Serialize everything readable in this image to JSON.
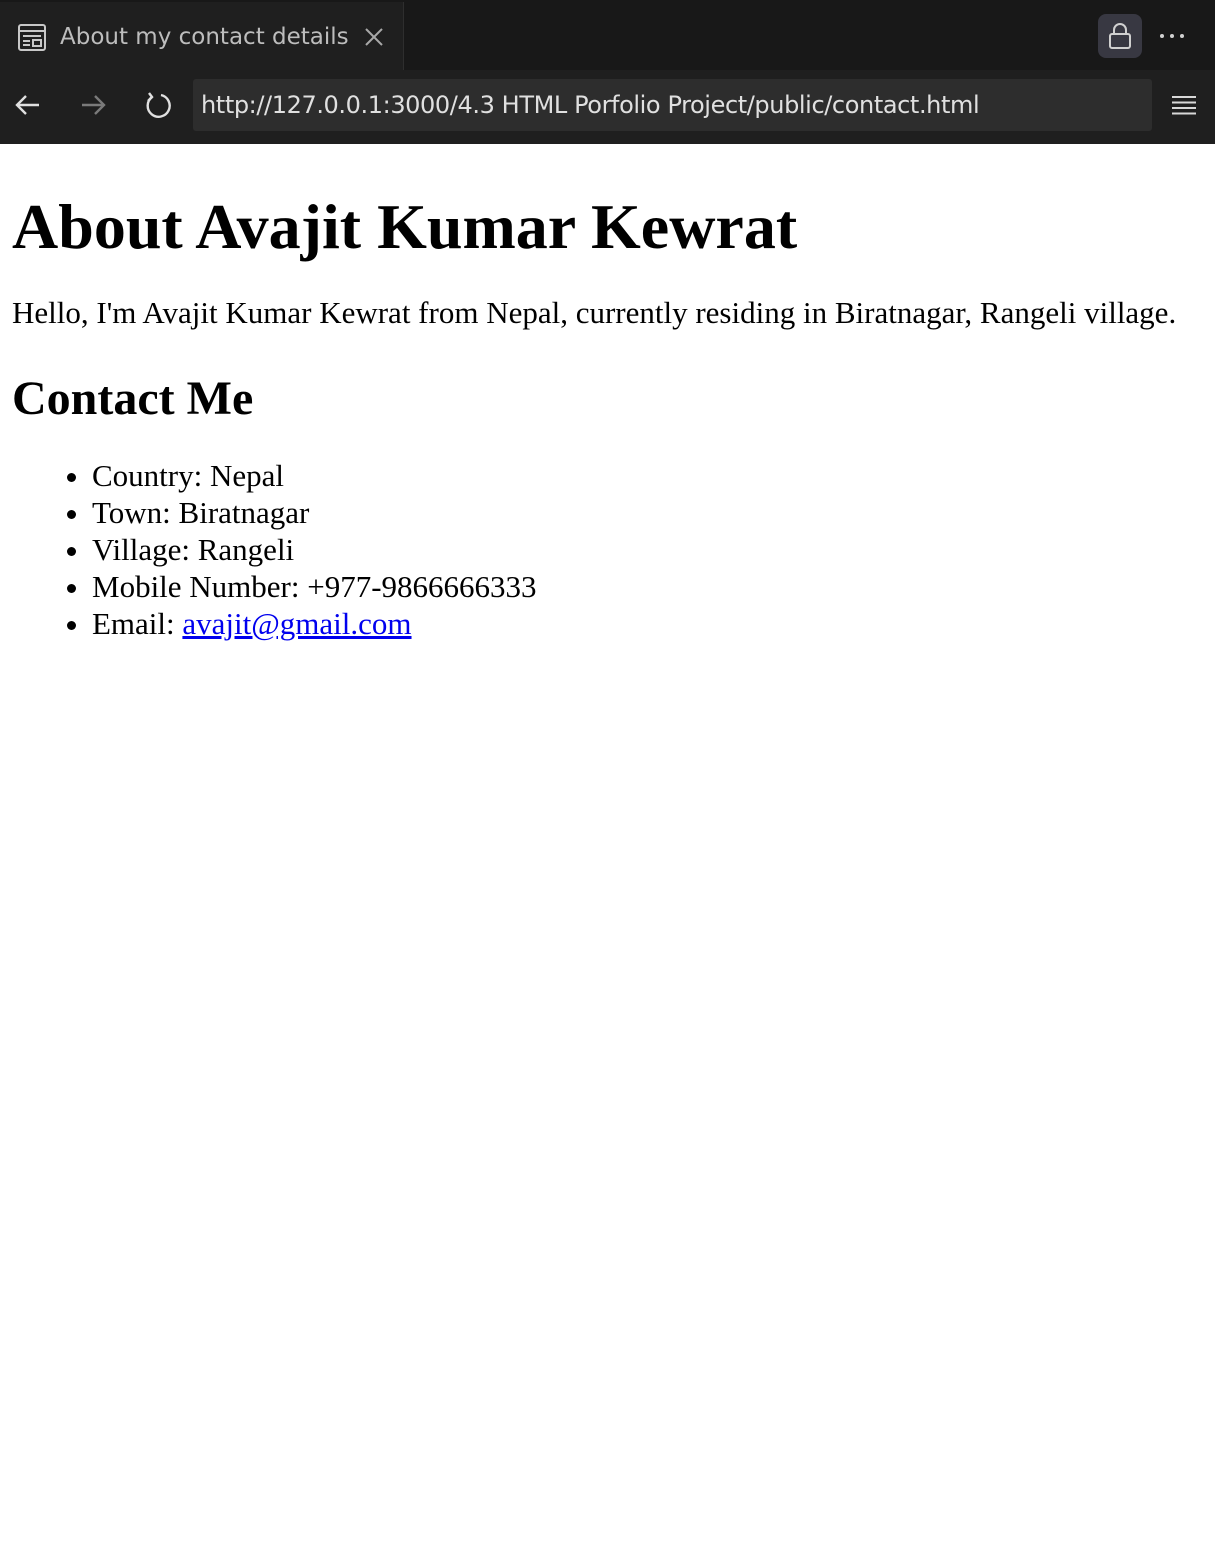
{
  "browser": {
    "tab": {
      "title": "About my contact details",
      "icon": "reader-view-icon"
    },
    "address_bar": {
      "url": "http://127.0.0.1:3000/4.3 HTML Porfolio Project/public/contact.html"
    },
    "icons": {
      "lock": "lock-icon",
      "more": "more-icon",
      "back": "back-arrow-icon",
      "forward": "forward-arrow-icon",
      "reload": "reload-icon",
      "menu": "hamburger-menu-icon",
      "close": "close-icon"
    },
    "colors": {
      "chrome_bg": "#1f1f1f",
      "tabbar_bg": "#181818",
      "address_bg": "#2d2d2d",
      "link": "#0000ee"
    }
  },
  "page": {
    "heading": "About Avajit Kumar Kewrat",
    "intro": "Hello, I'm Avajit Kumar Kewrat from Nepal, currently residing in Biratnagar, Rangeli village.",
    "contact_heading": "Contact Me",
    "contact_items": [
      {
        "label": "Country: ",
        "value": "Nepal"
      },
      {
        "label": "Town: ",
        "value": "Biratnagar"
      },
      {
        "label": "Village: ",
        "value": "Rangeli"
      },
      {
        "label": "Mobile Number: ",
        "value": "+977-9866666333"
      },
      {
        "label": "Email: ",
        "value": "avajit@gmail.com"
      }
    ]
  }
}
